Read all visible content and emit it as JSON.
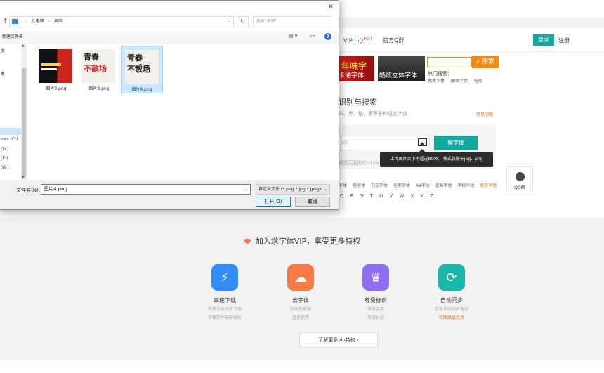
{
  "website": {
    "nav": {
      "vip": "VIP中心",
      "hot_badge": "HOT",
      "qq": "官方Q群"
    },
    "login": "登录",
    "register": "注册",
    "banners": [
      {
        "text": "年味字",
        "caption": "卡通字体"
      },
      {
        "text": "酷炫立体字体"
      }
    ],
    "search_button": "搜索",
    "hot_search_label": "热门搜索：",
    "hot_search_links": [
      "免费字体",
      "图案字体",
      "电商"
    ],
    "section_title": "识别与搜索",
    "section_subtitle": "宋、黑、楷、隶等多种语言字体",
    "section_link": "常见问题",
    "upload_placeholder": "JW",
    "find_button": "搜字体",
    "tooltip": "上传图片大小不超过800K，格式仅限于jpg、png",
    "paste_hint": "截图后粘贴Ctrl+V",
    "hot_fonts": [
      "字体",
      "粗字体",
      "书法字体",
      "毛笔字体",
      "Aa字体",
      "漫画字体",
      "手绘字体"
    ],
    "hot_fonts_more": "更多字体",
    "letters": [
      "Q",
      "R",
      "S",
      "T",
      "U",
      "V",
      "W",
      "X",
      "Y",
      "Z"
    ],
    "qq_group": "QQ群",
    "vip_title": "加入求字体VIP，享受更多特权",
    "features": [
      {
        "icon": "lightning-icon",
        "name": "高速下载",
        "desc1": "免费字体同步下载",
        "desc2": "字体软件无需排队",
        "color": "#2f8df5"
      },
      {
        "icon": "cloud-icon",
        "name": "云字体",
        "desc1": "字体免安装",
        "desc2": "直接使用",
        "color": "#f47b45"
      },
      {
        "icon": "badge-icon",
        "name": "尊贵标识",
        "desc1": "尊享会员",
        "desc2": "专属标识",
        "color": "#8f6ff0"
      },
      {
        "icon": "sync-icon",
        "name": "自动同步",
        "desc1": "字体自动同步备份",
        "desc2": "仅限高级会员",
        "color": "#1bb5aa"
      }
    ],
    "more_vip": "了解更多vip特权"
  },
  "dialog": {
    "close": "✕",
    "up_arrow": "↑",
    "breadcrumb": [
      "此电脑",
      "桌面"
    ],
    "search_placeholder": "搜索\"桌面\"",
    "new_folder": "新建文件夹",
    "help": "?",
    "nav_items": [
      "夹",
      "象",
      "ows (C:)",
      "(D:)",
      "(E:)",
      "(G:)"
    ],
    "files": [
      {
        "name": "图片2.png",
        "selected": false
      },
      {
        "name": "图片3.png",
        "selected": false,
        "line1": "青春",
        "line2": "不散场"
      },
      {
        "name": "图片4.png",
        "selected": true,
        "line1": "青春",
        "line2": "不散场"
      }
    ],
    "filename_label": "文件名(N):",
    "filename_value": "图片4.png",
    "filetype": "自定义文件 (*.png;*.jpg;*.jpeg)",
    "open": "打开(O)",
    "cancel": "取消"
  }
}
